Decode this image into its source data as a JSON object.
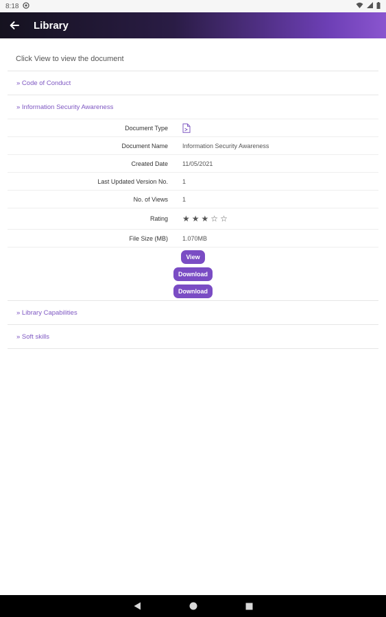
{
  "status_bar": {
    "time": "8:18"
  },
  "app_bar": {
    "title": "Library",
    "back_icon": "arrow-left-icon"
  },
  "instruction": "Click View to view the document",
  "sections": [
    {
      "label": "» Code of Conduct"
    },
    {
      "label": "» Information Security Awareness"
    },
    {
      "label": "» Library Capabilities"
    },
    {
      "label": "» Soft skills"
    }
  ],
  "document": {
    "type_label": "Document Type",
    "type_icon": "document-file-icon",
    "name_label": "Document Name",
    "name_value": "Information Security Awareness",
    "created_label": "Created Date",
    "created_value": "11/05/2021",
    "version_label": "Last Updated Version No.",
    "version_value": "1",
    "views_label": "No. of Views",
    "views_value": "1",
    "rating_label": "Rating",
    "rating_value": 3,
    "rating_max": 5,
    "size_label": "File Size (MB)",
    "size_value": "1.070MB"
  },
  "buttons": {
    "view": "View",
    "download1": "Download",
    "download2": "Download"
  },
  "colors": {
    "accent": "#7a4cc4",
    "link": "#7e57c2",
    "appbar_start": "#15121f",
    "appbar_end": "#8a55cf"
  }
}
